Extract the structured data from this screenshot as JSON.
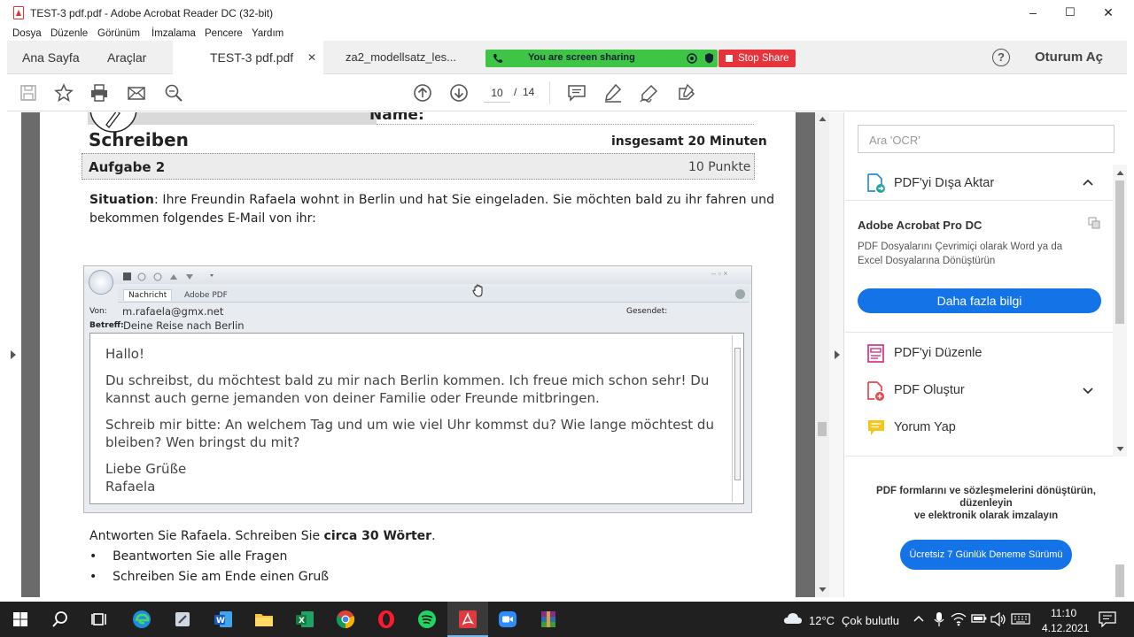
{
  "window": {
    "title": "TEST-3 pdf.pdf - Adobe Acrobat Reader DC (32-bit)",
    "minimize": "–",
    "maximize": "☐",
    "close": "✕"
  },
  "menu": [
    "Dosya",
    "Düzenle",
    "Görünüm",
    "İmzalama",
    "Pencere",
    "Yardım"
  ],
  "tabs": {
    "home": "Ana Sayfa",
    "tools": "Araçlar",
    "doc1": "TEST-3 pdf.pdf",
    "doc1_close": "✕",
    "doc2": "za2_modellsatz_les..."
  },
  "screen_share": {
    "status": "You are screen sharing",
    "stop": "Stop Share"
  },
  "account": {
    "help": "?",
    "signin": "Oturum Aç"
  },
  "toolbar": {
    "page_current": "10",
    "page_sep": "/",
    "page_total": "14"
  },
  "document": {
    "name_label": "Name:",
    "section": "Schreiben",
    "duration": "insgesamt 20 Minuten",
    "task": "Aufgabe 2",
    "points": "10 Punkte",
    "situation_label": "Situation",
    "situation_text1": ": Ihre Freundin Rafaela wohnt in Berlin und hat Sie eingeladen. Sie möchten bald zu ihr fahren und",
    "situation_text2": "bekommen folgendes E-Mail von ihr:",
    "email": {
      "tab1": "Nachricht",
      "tab2": "Adobe PDF",
      "from_label": "Von:",
      "from": "m.rafaela@gmx.net",
      "sent_label": "Gesendet:",
      "subject_label": "Betreff:",
      "subject": "Deine Reise nach Berlin",
      "greeting": "Hallo!",
      "p1_l1": "Du schreibst, du möchtest bald zu mir nach Berlin kommen. Ich freue mich schon sehr! Du",
      "p1_l2": "kannst auch gerne jemanden von deiner Familie oder Freunde mitbringen.",
      "p2_l1": "Schreib mir bitte: An welchem Tag und um wie viel Uhr kommst du? Wie lange möchtest du",
      "p2_l2": "bleiben? Wen bringst du mit?",
      "closing": "Liebe Grüße",
      "signature": "Rafaela"
    },
    "instruction_prefix": "Antworten Sie Rafaela. Schreiben Sie ",
    "instruction_bold": "circa 30 Wörter",
    "instruction_suffix": ".",
    "bullets": [
      "Beantworten Sie alle Fragen",
      "Schreiben Sie am Ende einen Gruß"
    ]
  },
  "right_panel": {
    "search_placeholder": "Ara 'OCR'",
    "export": "PDF'yi Dışa Aktar",
    "promo_title": "Adobe Acrobat Pro DC",
    "promo_text1": "PDF Dosyalarını Çevrimiçi olarak Word ya da",
    "promo_text2": "Excel Dosyalarına Dönüştürün",
    "more_info": "Daha fazla bilgi",
    "edit": "PDF'yi Düzenle",
    "create": "PDF Oluştur",
    "comment": "Yorum Yap",
    "footer_l1": "PDF formlarını ve sözleşmelerini dönüştürün,",
    "footer_l2": "düzenleyin",
    "footer_l3": "ve elektronik olarak imzalayın",
    "trial": "Ücretsiz 7 Günlük Deneme Sürümü"
  },
  "taskbar": {
    "weather_temp": "12°C",
    "weather_desc": "Çok bulutlu",
    "time": "11:10",
    "date": "4.12.2021"
  },
  "colors": {
    "accent_blue": "#1473e6",
    "share_green": "#3ec545",
    "stop_red": "#e8333b"
  }
}
